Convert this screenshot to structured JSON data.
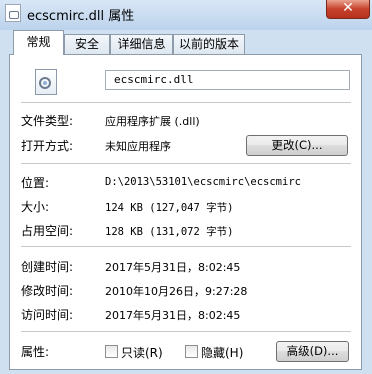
{
  "window": {
    "title": "ecscmirc.dll 属性",
    "close_label": "✕"
  },
  "tabs": [
    {
      "label": "常规",
      "active": true
    },
    {
      "label": "安全",
      "active": false
    },
    {
      "label": "详细信息",
      "active": false
    },
    {
      "label": "以前的版本",
      "active": false
    }
  ],
  "general": {
    "file_name": "ecscmirc.dll",
    "file_type_label": "文件类型:",
    "file_type_value": "应用程序扩展 (.dll)",
    "opens_with_label": "打开方式:",
    "opens_with_value": "未知应用程序",
    "change_button": "更改(C)...",
    "location_label": "位置:",
    "location_value": "D:\\2013\\53101\\ecscmirc\\ecscmirc",
    "size_label": "大小:",
    "size_value": "124 KB (127,047 字节)",
    "disk_size_label": "占用空间:",
    "disk_size_value": "128 KB (131,072 字节)",
    "created_label": "创建时间:",
    "created_value": "2017年5月31日，8:02:45",
    "modified_label": "修改时间:",
    "modified_value": "2010年10月26日，9:27:28",
    "accessed_label": "访问时间:",
    "accessed_value": "2017年5月31日，8:02:45",
    "attributes_label": "属性:",
    "readonly_label": "只读(R)",
    "hidden_label": "隐藏(H)",
    "advanced_button": "高级(D)..."
  }
}
